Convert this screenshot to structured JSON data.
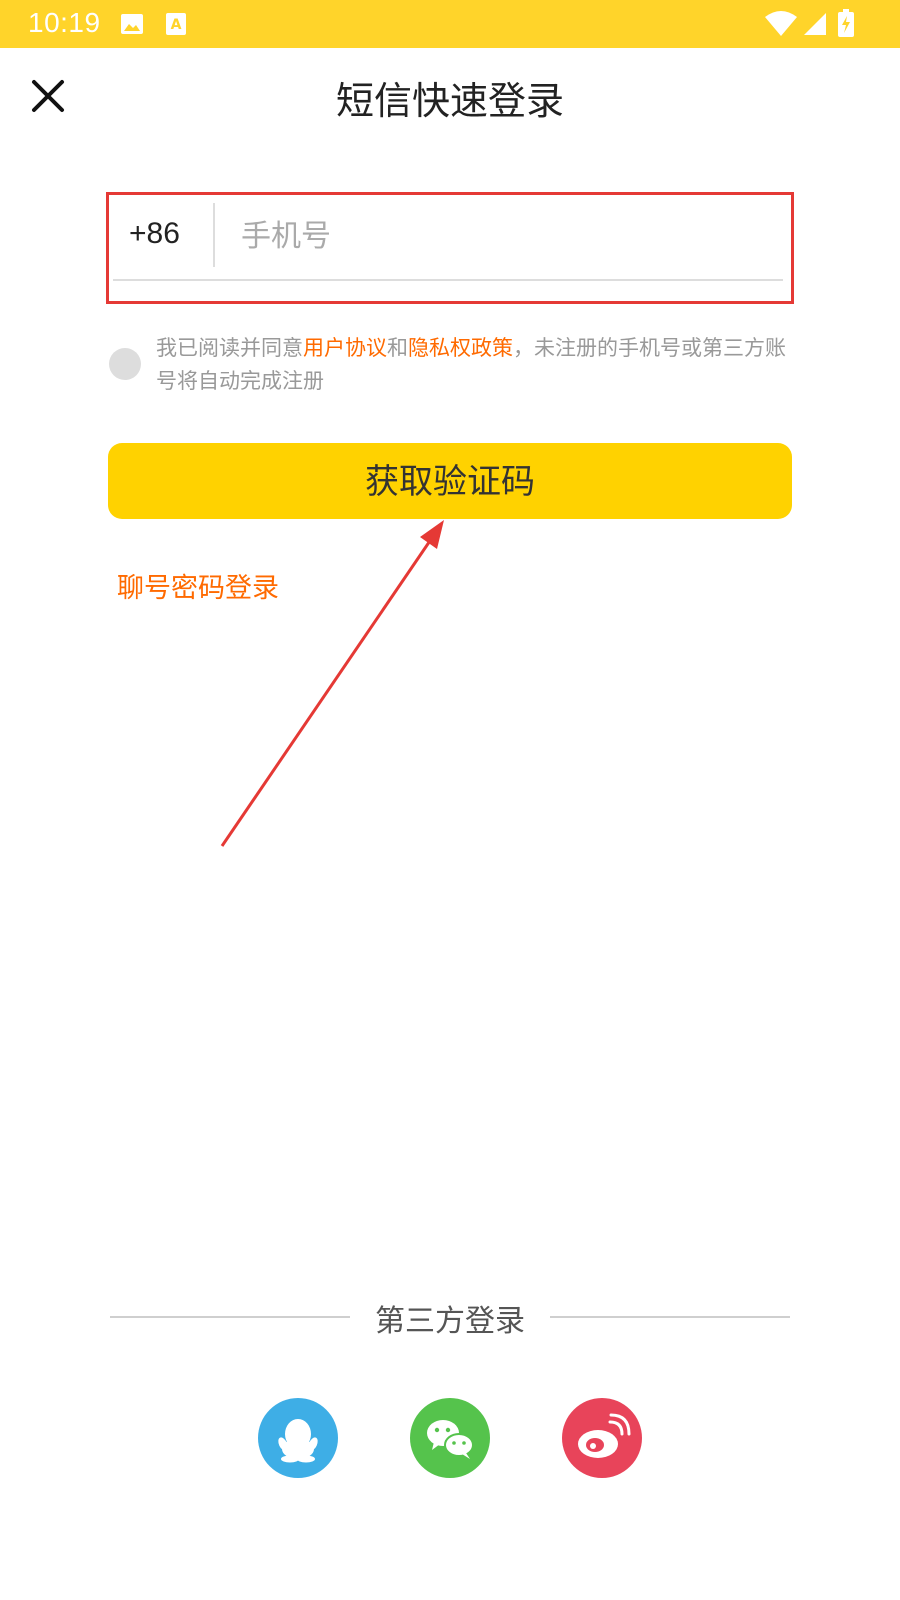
{
  "status_bar": {
    "time": "10:19",
    "icons": [
      "image-icon",
      "text-a-icon",
      "wifi-icon",
      "signal-icon",
      "battery-charging-icon"
    ],
    "bg_color": "#FFD42A"
  },
  "header": {
    "close_icon": "close-icon",
    "title": "短信快速登录"
  },
  "phone_form": {
    "country_code": "+86",
    "phone_placeholder": "手机号",
    "phone_value": ""
  },
  "agreement": {
    "checked": false,
    "text_prefix": "我已阅读并同意",
    "user_agreement": "用户协议",
    "and": "和",
    "privacy_policy": "隐私权政策",
    "text_suffix": "，未注册的手机号或第三方账号将自动完成注册",
    "link_color": "#FF6A00"
  },
  "actions": {
    "get_code_label": "获取验证码",
    "get_code_color": "#FFD200",
    "password_login_label": "聊号密码登录"
  },
  "third_party": {
    "label": "第三方登录",
    "providers": [
      {
        "icon": "qq-icon",
        "color": "#3EAEE6"
      },
      {
        "icon": "wechat-icon",
        "color": "#55C34C"
      },
      {
        "icon": "weibo-icon",
        "color": "#E8445A"
      }
    ]
  },
  "annotation": {
    "highlight_color": "#E53935"
  }
}
